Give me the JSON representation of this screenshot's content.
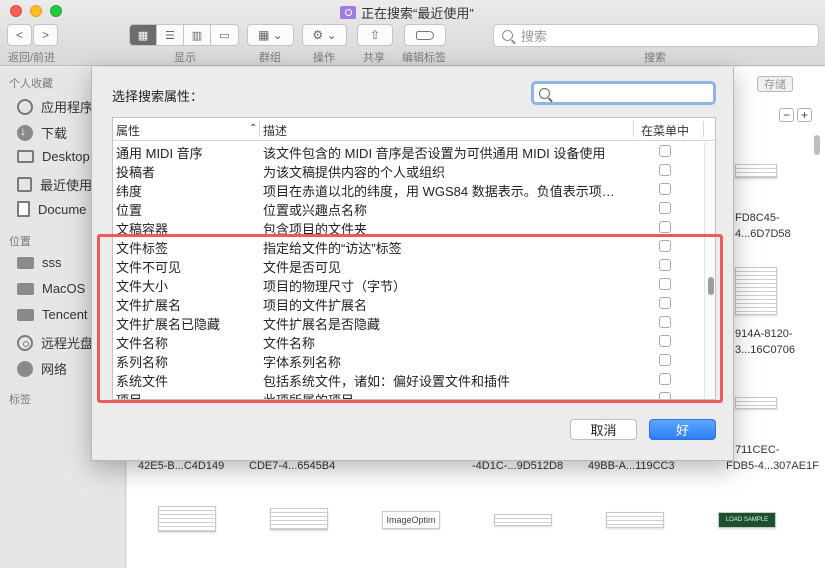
{
  "window": {
    "title": "正在搜索“最近使用”"
  },
  "toolbar": {
    "back_label": "<",
    "forward_label": ">",
    "nav_caption": "返回/前进",
    "view_caption": "显示",
    "group_caption": "群组",
    "action_caption": "操作",
    "share_caption": "共享",
    "tags_caption": "编辑标签",
    "search_caption": "搜索",
    "search_placeholder": "搜索"
  },
  "sidebar": {
    "favorites_header": "个人收藏",
    "favorites": [
      {
        "label": "应用程序",
        "icon": "applications-icon"
      },
      {
        "label": "下载",
        "icon": "downloads-icon"
      },
      {
        "label": "Desktop",
        "icon": "desktop-icon"
      },
      {
        "label": "最近使用",
        "icon": "recents-icon"
      },
      {
        "label": "Docume",
        "icon": "documents-icon"
      }
    ],
    "locations_header": "位置",
    "locations": [
      {
        "label": "sss",
        "icon": "disk-icon"
      },
      {
        "label": "MacOS",
        "icon": "disk-icon"
      },
      {
        "label": "Tencent",
        "icon": "disk-icon"
      },
      {
        "label": "远程光盘",
        "icon": "remote-disc-icon"
      },
      {
        "label": "网络",
        "icon": "network-icon"
      }
    ],
    "tags_header": "标签"
  },
  "content": {
    "save_label": "存储",
    "minus_label": "−",
    "plus_label": "+",
    "filenames_right": [
      "FD8C45-",
      "4...6D7D58",
      "914A-8120-",
      "3...16C0706",
      "711CEC-",
      "FDB5-4...307AE1F"
    ],
    "filenames_bottom": [
      "42E5-B...C4D149",
      "CDE7-4...6545B4",
      "-4D1C-...9D512D8",
      "49BB-A...119CC3"
    ],
    "thumb_texts": [
      "ImageOptim",
      "LOAD SAMPLE"
    ]
  },
  "dialog": {
    "title": "选择搜索属性：",
    "search_value": "",
    "columns": {
      "attribute": "属性",
      "description": "描述",
      "in_menu": "在菜单中"
    },
    "rows": [
      {
        "name": "通用 MIDI 音序",
        "desc": "该文件包含的 MIDI 音序是否设置为可供通用 MIDI 设备使用",
        "checked": false
      },
      {
        "name": "投稿者",
        "desc": "为该文稿提供内容的个人或组织",
        "checked": false
      },
      {
        "name": "纬度",
        "desc": "项目在赤道以北的纬度，用 WGS84 数据表示。负值表示项…",
        "checked": false
      },
      {
        "name": "位置",
        "desc": "位置或兴趣点名称",
        "checked": false
      },
      {
        "name": "文稿容器",
        "desc": "包含项目的文件夹",
        "checked": false
      },
      {
        "name": "文件标签",
        "desc": "指定给文件的“访达”标签",
        "checked": false
      },
      {
        "name": "文件不可见",
        "desc": "文件是否可见",
        "checked": false
      },
      {
        "name": "文件大小",
        "desc": "项目的物理尺寸（字节）",
        "checked": false
      },
      {
        "name": "文件扩展名",
        "desc": "项目的文件扩展名",
        "checked": false
      },
      {
        "name": "文件扩展名已隐藏",
        "desc": "文件扩展名是否隐藏",
        "checked": false
      },
      {
        "name": "文件名称",
        "desc": "文件名称",
        "checked": false
      },
      {
        "name": "系列名称",
        "desc": "字体系列名称",
        "checked": false
      },
      {
        "name": "系统文件",
        "desc": "包括系统文件，诸如：偏好设置文件和插件",
        "checked": false
      },
      {
        "name": "项目",
        "desc": "此项所属的项目",
        "checked": false
      }
    ],
    "cancel_label": "取消",
    "ok_label": "好"
  },
  "colors": {
    "accent": "#2c7ff3",
    "highlight_box": "#ec5a5c"
  }
}
